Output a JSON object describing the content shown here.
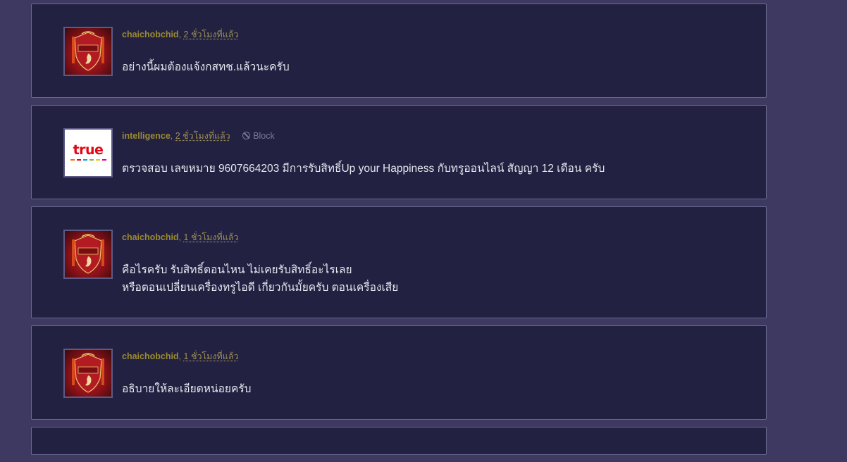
{
  "comments": [
    {
      "author": "chaichobchid",
      "time": "2 ชั่วโมงที่แล้ว",
      "avatar": "liverpool-crest",
      "lines": [
        "อย่างนี้ผมต้องแจ้งกสทช.แล้วนะครับ"
      ]
    },
    {
      "author": "intelligence",
      "time": "2 ชั่วโมงที่แล้ว",
      "avatar": "true-logo",
      "avatar_text": "true",
      "block_label": "Block",
      "lines": [
        "ตรวจสอบ เลขหมาย 9607664203 มีการรับสิทธิ์Up your Happiness กับทรูออนไลน์ สัญญา 12 เดือน  ครับ"
      ]
    },
    {
      "author": "chaichobchid",
      "time": "1 ชั่วโมงที่แล้ว",
      "avatar": "liverpool-crest",
      "lines": [
        "คือไรครับ รับสิทธิ์ตอนไหน ไม่เคยรับสิทธิ์อะไรเลย",
        "หรือตอนเปลี่ยนเครื่องทรูไอดี เกี่ยวกันมั้ยครับ ตอนเครื่องเสีย"
      ]
    },
    {
      "author": "chaichobchid",
      "time": "1 ชั่วโมงที่แล้ว",
      "avatar": "liverpool-crest",
      "lines": [
        "อธิบายให้ละเอียดหน่อยครับ"
      ]
    }
  ],
  "colors": {
    "page_bg": "#3e3960",
    "card_bg": "#222142",
    "card_border": "#6a6890",
    "author": "#9b8a2d",
    "text": "#e6e6ee"
  }
}
